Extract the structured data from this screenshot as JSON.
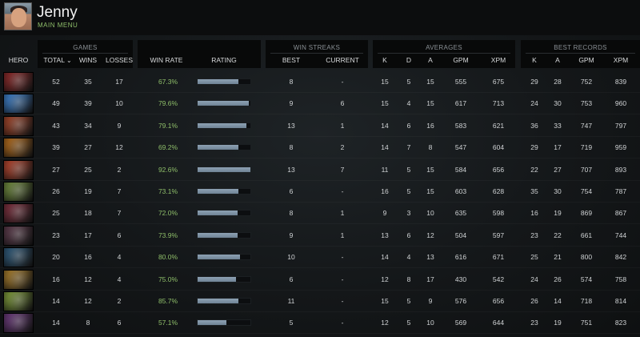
{
  "header": {
    "username": "Jenny",
    "menu_link": "MAIN MENU"
  },
  "groups": {
    "games": "GAMES",
    "win_streaks": "WIN STREAKS",
    "averages": "AVERAGES",
    "best_records": "BEST RECORDS"
  },
  "columns": {
    "hero": "HERO",
    "total": "TOTAL",
    "total_sort_icon": "⌄",
    "wins": "WINS",
    "losses": "LOSSES",
    "win_rate": "WIN RATE",
    "rating": "RATING",
    "best": "BEST",
    "current": "CURRENT",
    "k": "K",
    "d": "D",
    "a": "A",
    "gpm": "GPM",
    "xpm": "XPM",
    "best_k": "K",
    "best_a": "A",
    "best_gpm": "GPM",
    "best_xpm": "XPM"
  },
  "colors": {
    "win_rate_text": "#8fbf6a",
    "rating_bar": "#8ea2b4",
    "menu_link": "#8fbf6a"
  },
  "rows": [
    {
      "hero_color": "#8a2a2a",
      "total": "52",
      "wins": "35",
      "losses": "17",
      "win_rate": "67.3%",
      "rating": 0.78,
      "best": "8",
      "current": "-",
      "k": "15",
      "d": "5",
      "a": "15",
      "gpm": "555",
      "xpm": "675",
      "bk": "29",
      "ba": "28",
      "bgpm": "752",
      "bxpm": "839"
    },
    {
      "hero_color": "#3d7fc9",
      "total": "49",
      "wins": "39",
      "losses": "10",
      "win_rate": "79.6%",
      "rating": 0.97,
      "best": "9",
      "current": "6",
      "k": "15",
      "d": "4",
      "a": "15",
      "gpm": "617",
      "xpm": "713",
      "bk": "24",
      "ba": "30",
      "bgpm": "753",
      "bxpm": "960"
    },
    {
      "hero_color": "#a0452a",
      "total": "43",
      "wins": "34",
      "losses": "9",
      "win_rate": "79.1%",
      "rating": 0.92,
      "best": "13",
      "current": "1",
      "k": "14",
      "d": "6",
      "a": "16",
      "gpm": "583",
      "xpm": "621",
      "bk": "36",
      "ba": "33",
      "bgpm": "747",
      "bxpm": "797"
    },
    {
      "hero_color": "#b06a1c",
      "total": "39",
      "wins": "27",
      "losses": "12",
      "win_rate": "69.2%",
      "rating": 0.77,
      "best": "8",
      "current": "2",
      "k": "14",
      "d": "7",
      "a": "8",
      "gpm": "547",
      "xpm": "604",
      "bk": "29",
      "ba": "17",
      "bgpm": "719",
      "bxpm": "959"
    },
    {
      "hero_color": "#b3452e",
      "total": "27",
      "wins": "25",
      "losses": "2",
      "win_rate": "92.6%",
      "rating": 1.0,
      "best": "13",
      "current": "7",
      "k": "11",
      "d": "5",
      "a": "15",
      "gpm": "584",
      "xpm": "656",
      "bk": "22",
      "ba": "27",
      "bgpm": "707",
      "bxpm": "893"
    },
    {
      "hero_color": "#6f8a3e",
      "total": "26",
      "wins": "19",
      "losses": "7",
      "win_rate": "73.1%",
      "rating": 0.77,
      "best": "6",
      "current": "-",
      "k": "16",
      "d": "5",
      "a": "15",
      "gpm": "603",
      "xpm": "628",
      "bk": "35",
      "ba": "30",
      "bgpm": "754",
      "bxpm": "787"
    },
    {
      "hero_color": "#7a2f3d",
      "total": "25",
      "wins": "18",
      "losses": "7",
      "win_rate": "72.0%",
      "rating": 0.76,
      "best": "8",
      "current": "1",
      "k": "9",
      "d": "3",
      "a": "10",
      "gpm": "635",
      "xpm": "598",
      "bk": "16",
      "ba": "19",
      "bgpm": "869",
      "bxpm": "867"
    },
    {
      "hero_color": "#5a3a4a",
      "total": "23",
      "wins": "17",
      "losses": "6",
      "win_rate": "73.9%",
      "rating": 0.76,
      "best": "9",
      "current": "1",
      "k": "13",
      "d": "6",
      "a": "12",
      "gpm": "504",
      "xpm": "597",
      "bk": "23",
      "ba": "22",
      "bgpm": "661",
      "bxpm": "744"
    },
    {
      "hero_color": "#2f5a7a",
      "total": "20",
      "wins": "16",
      "losses": "4",
      "win_rate": "80.0%",
      "rating": 0.8,
      "best": "10",
      "current": "-",
      "k": "14",
      "d": "4",
      "a": "13",
      "gpm": "616",
      "xpm": "671",
      "bk": "25",
      "ba": "21",
      "bgpm": "800",
      "bxpm": "842"
    },
    {
      "hero_color": "#a67c2c",
      "total": "16",
      "wins": "12",
      "losses": "4",
      "win_rate": "75.0%",
      "rating": 0.72,
      "best": "6",
      "current": "-",
      "k": "12",
      "d": "8",
      "a": "17",
      "gpm": "430",
      "xpm": "542",
      "bk": "24",
      "ba": "26",
      "bgpm": "574",
      "bxpm": "758"
    },
    {
      "hero_color": "#7d9a3a",
      "total": "14",
      "wins": "12",
      "losses": "2",
      "win_rate": "85.7%",
      "rating": 0.78,
      "best": "11",
      "current": "-",
      "k": "15",
      "d": "5",
      "a": "9",
      "gpm": "576",
      "xpm": "656",
      "bk": "26",
      "ba": "14",
      "bgpm": "718",
      "bxpm": "814"
    },
    {
      "hero_color": "#6a3a7a",
      "total": "14",
      "wins": "8",
      "losses": "6",
      "win_rate": "57.1%",
      "rating": 0.55,
      "best": "5",
      "current": "-",
      "k": "12",
      "d": "5",
      "a": "10",
      "gpm": "569",
      "xpm": "644",
      "bk": "23",
      "ba": "19",
      "bgpm": "751",
      "bxpm": "823"
    }
  ]
}
